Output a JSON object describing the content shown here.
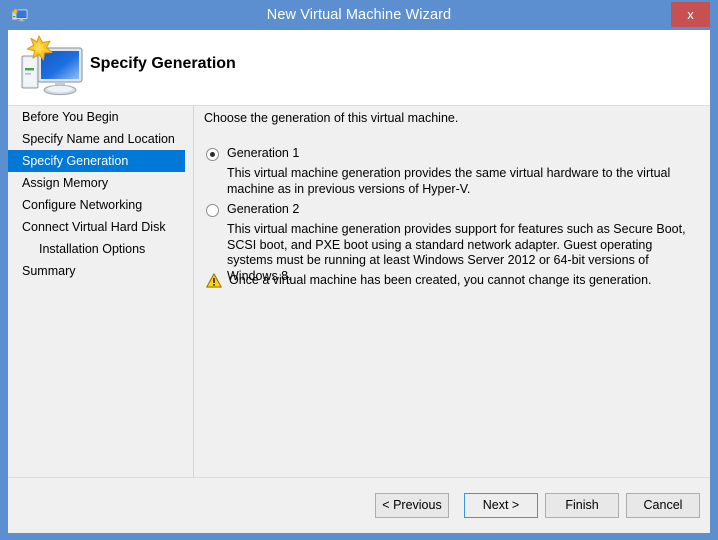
{
  "window": {
    "title": "New Virtual Machine Wizard",
    "title_icon": "vm-wizard-icon",
    "close_label": "x",
    "titlebar_color": "#5b8fd0",
    "close_color": "#c75050"
  },
  "header": {
    "title": "Specify Generation",
    "icon": "computer-new-icon"
  },
  "sidebar": {
    "selected_index": 2,
    "accent_color": "#0078d7",
    "items": [
      {
        "label": "Before You Begin",
        "indent": false
      },
      {
        "label": "Specify Name and Location",
        "indent": false
      },
      {
        "label": "Specify Generation",
        "indent": false
      },
      {
        "label": "Assign Memory",
        "indent": false
      },
      {
        "label": "Configure Networking",
        "indent": false
      },
      {
        "label": "Connect Virtual Hard Disk",
        "indent": false
      },
      {
        "label": "Installation Options",
        "indent": true
      },
      {
        "label": "Summary",
        "indent": false
      }
    ]
  },
  "content": {
    "intro": "Choose the generation of this virtual machine.",
    "options": [
      {
        "label": "Generation 1",
        "selected": true,
        "description": "This virtual machine generation provides the same virtual hardware to the virtual machine as in previous versions of Hyper-V."
      },
      {
        "label": "Generation 2",
        "selected": false,
        "description": "This virtual machine generation provides support for features such as Secure Boot, SCSI boot, and PXE boot using a standard network adapter. Guest operating systems must be running at least Windows Server 2012 or 64-bit versions of Windows 8."
      }
    ],
    "warning": {
      "icon": "warning-triangle-icon",
      "text": "Once a virtual machine has been created, you cannot change its generation.",
      "color": "#ffcc00"
    }
  },
  "footer": {
    "buttons": [
      {
        "label": "< Previous",
        "default": false
      },
      {
        "label": "Next >",
        "default": true
      },
      {
        "label": "Finish",
        "default": false
      },
      {
        "label": "Cancel",
        "default": false
      }
    ]
  }
}
